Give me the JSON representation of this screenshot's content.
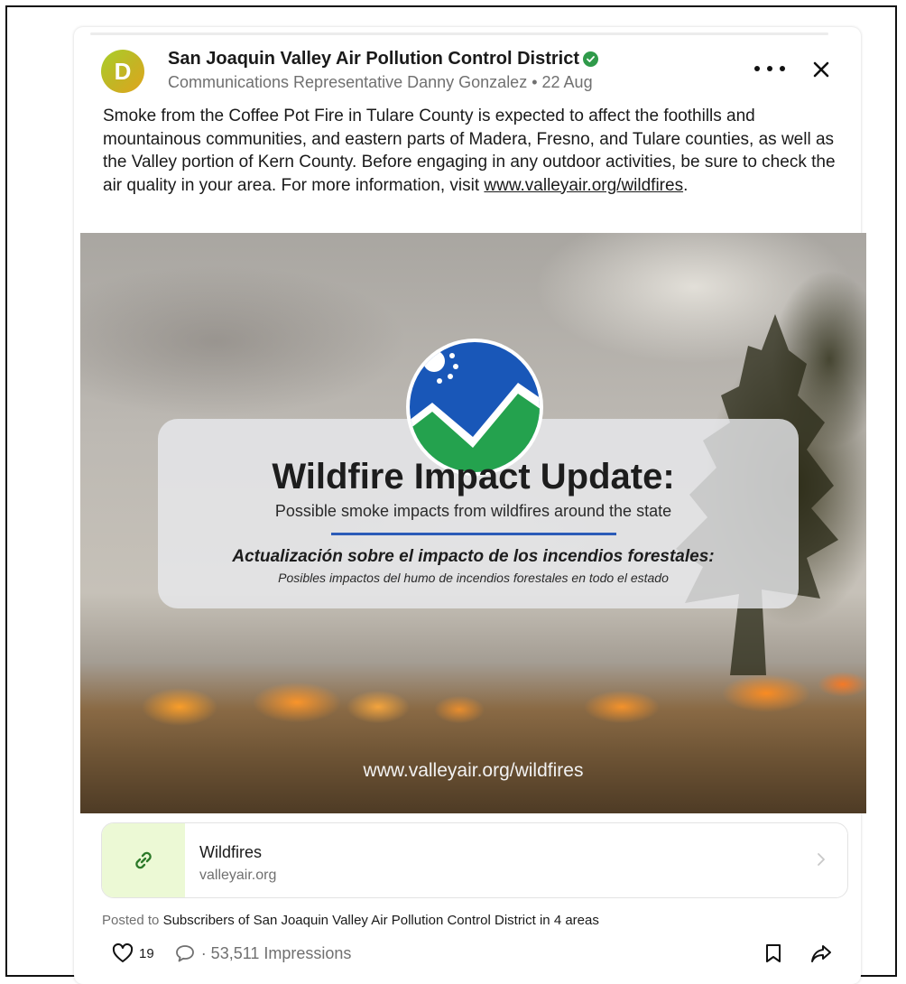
{
  "post": {
    "avatar_initial": "D",
    "author_name": "San Joaquin Valley Air Pollution Control District",
    "byline": "Communications Representative Danny Gonzalez",
    "date": "• 22 Aug",
    "body_text": "Smoke from the Coffee Pot Fire in Tulare County is expected to affect the foothills and mountainous communities, and eastern parts of Madera, Fresno, and Tulare counties, as well as the Valley portion of Kern County. Before engaging in any outdoor activities, be sure to check the air quality in your area. For more information, visit",
    "body_link": "www.valleyair.org/wildfires",
    "body_trailing": "."
  },
  "image": {
    "title": "Wildfire Impact Update:",
    "subtitle": "Possible smoke impacts from wildfires around the state",
    "es_title": "Actualización sobre el impacto de los incendios forestales:",
    "es_subtitle": "Posibles impactos del humo de incendios forestales en todo el estado",
    "url": "www.valleyair.org/wildfires"
  },
  "link_preview": {
    "title": "Wildfires",
    "domain": "valleyair.org",
    "icon": "link-icon"
  },
  "posted_to": {
    "prefix": "Posted to",
    "audience": "Subscribers of San Joaquin Valley Air Pollution Control District in 4 areas"
  },
  "stats": {
    "likes": "19",
    "impressions": "· 53,511 Impressions"
  },
  "icons": [
    "verified-badge-icon",
    "more-options-icon",
    "close-icon",
    "heart-icon",
    "comment-icon",
    "bookmark-icon",
    "share-icon",
    "chevron-right-icon"
  ],
  "colors": {
    "verified": "#2f9a4a",
    "link_thumb_bg": "#ecf9d5",
    "logo_blue": "#1957b8",
    "logo_green": "#24a24e"
  }
}
